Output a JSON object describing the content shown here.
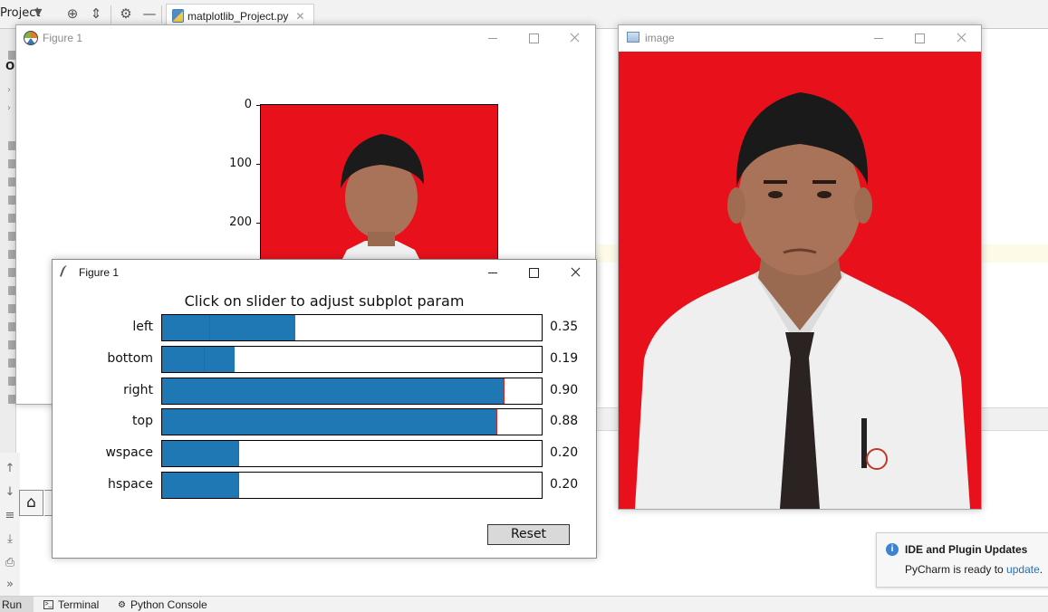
{
  "ide": {
    "project_label": "Project",
    "toolbar_icons": [
      "target-icon",
      "collapse-icon",
      "gear-icon",
      "minus-icon"
    ],
    "editor_tab": {
      "label": "matplotlib_Project.py"
    },
    "gutter_letter": "O",
    "bottom_tabs": {
      "run": "Run",
      "terminal": "Terminal",
      "python_console": "Python Console"
    },
    "notification": {
      "title": "IDE and Plugin Updates",
      "body_prefix": "PyCharm is ready to ",
      "link": "update",
      "body_suffix": "."
    }
  },
  "figure_window": {
    "title": "Figure 1",
    "y_ticks": [
      "0",
      "100",
      "200"
    ]
  },
  "image_window": {
    "title": "image"
  },
  "subplot_tool": {
    "title": "Figure 1",
    "heading": "Click on slider to adjust subplot param",
    "sliders": [
      {
        "label": "left",
        "value": "0.35",
        "fill": 0.35,
        "marker": 0.125
      },
      {
        "label": "bottom",
        "value": "0.19",
        "fill": 0.19,
        "marker": 0.11
      },
      {
        "label": "right",
        "value": "0.90",
        "fill": 0.9,
        "marker": 0.9
      },
      {
        "label": "top",
        "value": "0.88",
        "fill": 0.88,
        "marker": 0.88
      },
      {
        "label": "wspace",
        "value": "0.20",
        "fill": 0.2,
        "marker": 0.2
      },
      {
        "label": "hspace",
        "value": "0.20",
        "fill": 0.2,
        "marker": 0.2
      }
    ],
    "reset_label": "Reset"
  },
  "colors": {
    "slider_fill": "#1f77b4",
    "slider_marker": "#d62728",
    "photo_background": "#e8111b"
  }
}
